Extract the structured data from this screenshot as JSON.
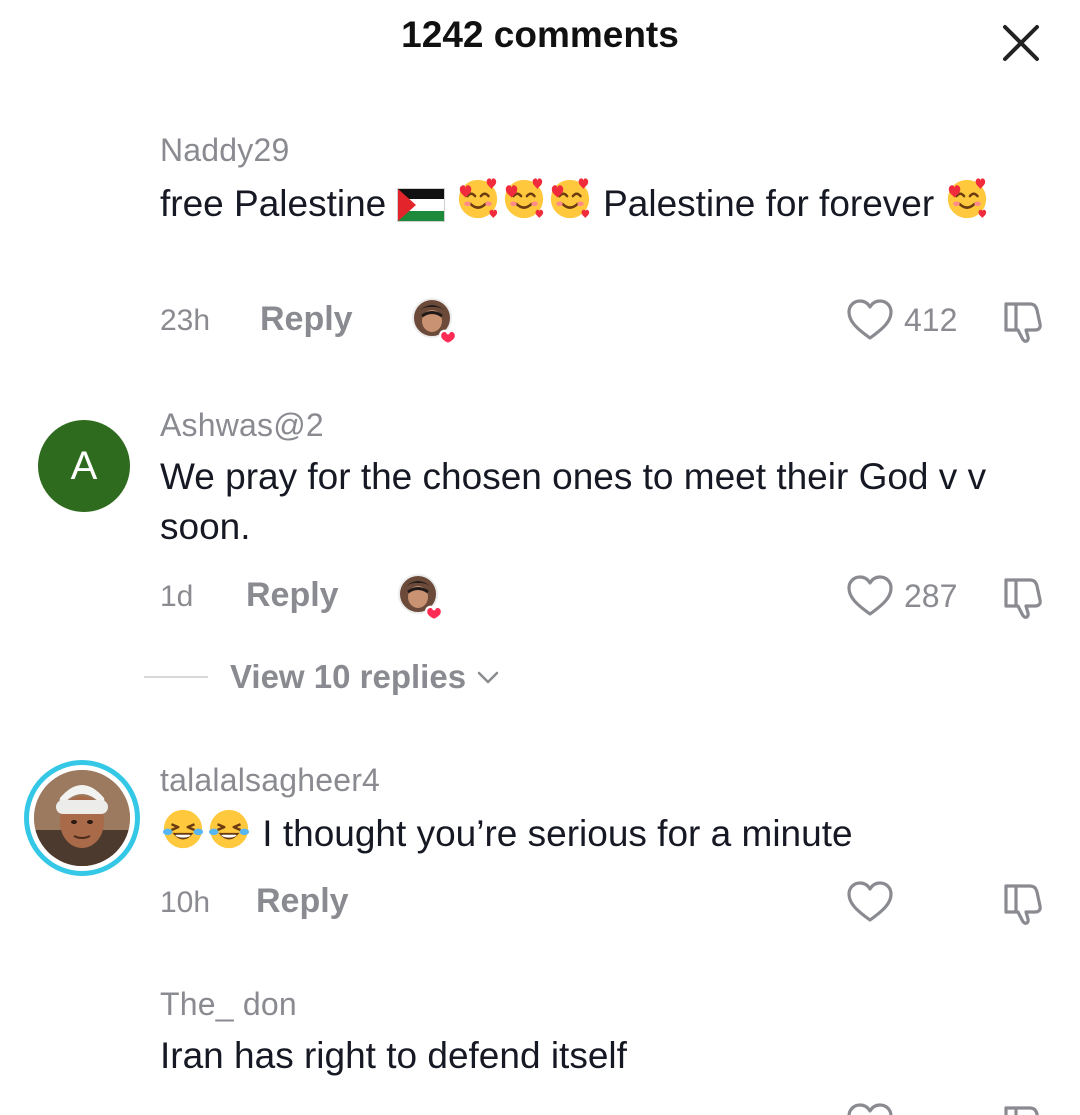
{
  "header": {
    "title": "1242 comments"
  },
  "comments": [
    {
      "username": "Naddy29",
      "text_part1": "free Palestine",
      "text_part2": "Palestine for forever",
      "time": "23h",
      "reply_label": "Reply",
      "likes": "412",
      "creator_liked": true
    },
    {
      "avatar_letter": "A",
      "username": "Ashwas@2",
      "text": "We pray for the chosen ones to meet their God v v soon.",
      "time": "1d",
      "reply_label": "Reply",
      "likes": "287",
      "creator_liked": true,
      "view_replies": "View 10 replies"
    },
    {
      "username": "talalalsagheer4",
      "text": "I thought you’re serious for a minute",
      "time": "10h",
      "reply_label": "Reply",
      "likes": ""
    },
    {
      "username": "The_ don",
      "text": "Iran has right to defend itself"
    }
  ],
  "icons": {
    "close": "close-icon",
    "heart": "heart-outline-icon",
    "dislike": "thumbs-down-icon",
    "flag": "palestine-flag-emoji",
    "smiling_hearts": "smiling-face-with-hearts-emoji",
    "tears_of_joy": "face-with-tears-of-joy-emoji"
  },
  "colors": {
    "avatar_a": "#2f6b1f",
    "story_ring": "#35c8e6",
    "liked_heart": "#fe2c55",
    "muted_text": "#8a8b91"
  }
}
